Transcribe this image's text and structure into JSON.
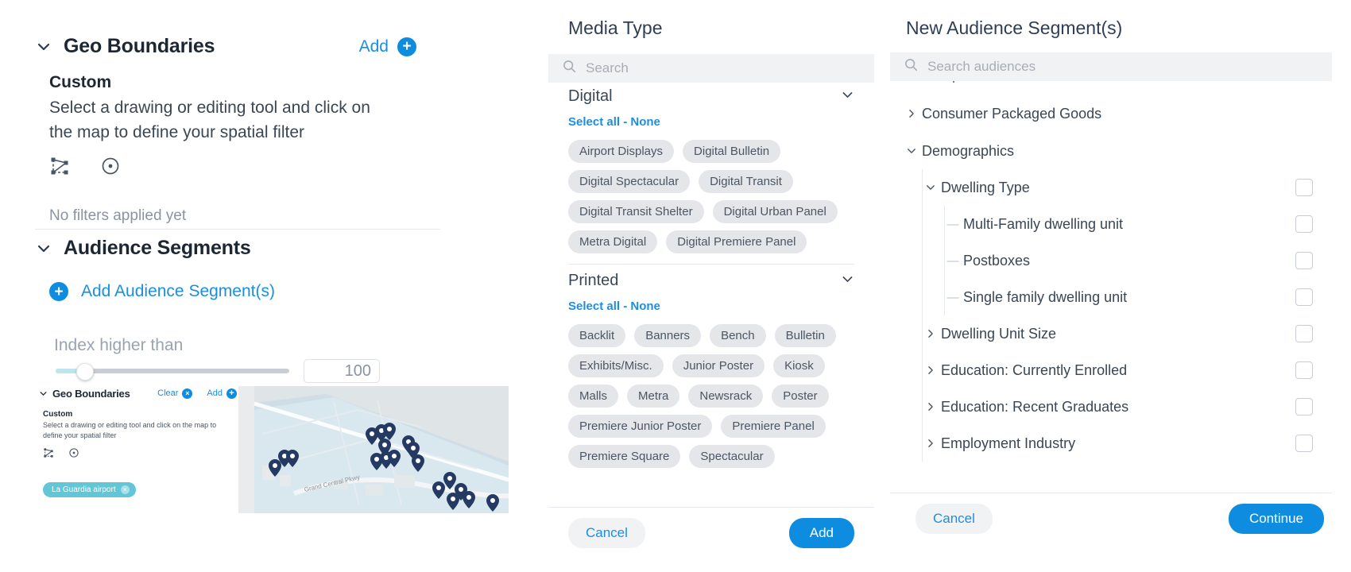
{
  "left": {
    "geo_boundaries": {
      "title": "Geo Boundaries",
      "add_label": "Add",
      "custom_title": "Custom",
      "custom_desc": "Select a drawing or editing tool and click on the map to define your spatial filter",
      "no_filters": "No filters applied yet"
    },
    "audience_segments": {
      "title": "Audience Segments",
      "add_label": "Add Audience Segment(s)"
    },
    "index_slider": {
      "label": "Index higher than",
      "value": "100"
    },
    "inset": {
      "title": "Geo Boundaries",
      "clear_label": "Clear",
      "add_label": "Add",
      "custom_title": "Custom",
      "custom_desc": "Select a drawing or editing tool and click on the map to define your spatial filter",
      "chip_label": "La Guardia airport",
      "map_road_label": "Grand Central Pkwy"
    }
  },
  "media_type": {
    "title": "Media Type",
    "search_placeholder": "Search",
    "groups": [
      {
        "name": "Digital",
        "select_all_label": "Select all - None",
        "items": [
          "Airport Displays",
          "Digital Bulletin",
          "Digital Spectacular",
          "Digital Transit",
          "Digital Transit Shelter",
          "Digital Urban Panel",
          "Metra Digital",
          "Digital Premiere Panel"
        ]
      },
      {
        "name": "Printed",
        "select_all_label": "Select all - None",
        "items": [
          "Backlit",
          "Banners",
          "Bench",
          "Bulletin",
          "Exhibits/Misc.",
          "Junior Poster",
          "Kiosk",
          "Malls",
          "Metra",
          "Newsrack",
          "Poster",
          "Premiere Junior Poster",
          "Premiere Panel",
          "Premiere Square",
          "Spectacular"
        ]
      }
    ],
    "cancel_label": "Cancel",
    "add_label": "Add"
  },
  "audience_panel": {
    "title": "New Audience Segment(s)",
    "search_placeholder": "Search audiences",
    "clipped_item": "Computers & Electronics",
    "tree": [
      {
        "label": "Consumer Packaged Goods",
        "level": 0,
        "state": "collapsed",
        "checkbox": false
      },
      {
        "label": "Demographics",
        "level": 0,
        "state": "expanded",
        "checkbox": false
      },
      {
        "label": "Dwelling Type",
        "level": 1,
        "state": "expanded",
        "checkbox": true
      },
      {
        "label": "Multi-Family dwelling unit",
        "level": 2,
        "state": "leaf",
        "checkbox": true
      },
      {
        "label": "Postboxes",
        "level": 2,
        "state": "leaf",
        "checkbox": true
      },
      {
        "label": "Single family dwelling unit",
        "level": 2,
        "state": "leaf",
        "checkbox": true
      },
      {
        "label": "Dwelling Unit Size",
        "level": 1,
        "state": "collapsed",
        "checkbox": true
      },
      {
        "label": "Education: Currently Enrolled",
        "level": 1,
        "state": "collapsed",
        "checkbox": true
      },
      {
        "label": "Education: Recent Graduates",
        "level": 1,
        "state": "collapsed",
        "checkbox": true
      },
      {
        "label": "Employment Industry",
        "level": 1,
        "state": "collapsed",
        "checkbox": true
      }
    ],
    "cancel_label": "Cancel",
    "continue_label": "Continue"
  },
  "colors": {
    "accent_blue": "#0e8de0",
    "link_blue": "#1a8fe0",
    "chip_gray": "#e4e6ea",
    "teal_chip": "#63c6d6",
    "pin_navy": "#253a63",
    "text_dark": "#1d2733"
  }
}
